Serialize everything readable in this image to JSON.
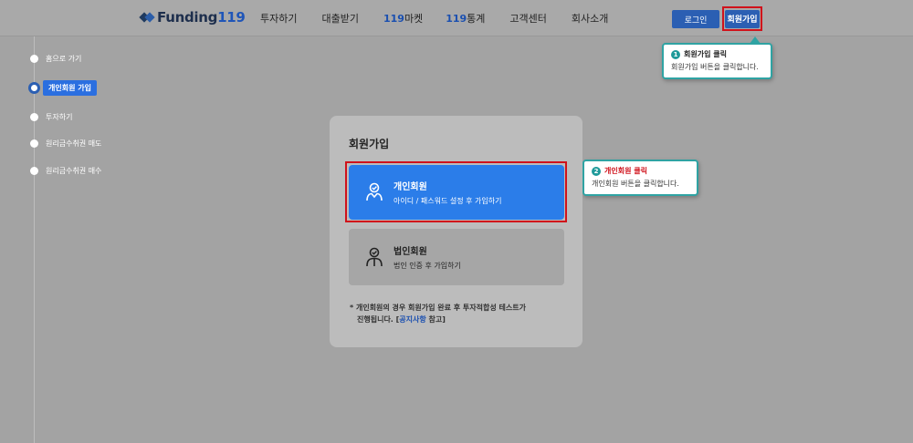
{
  "header": {
    "logo_text": "Funding",
    "logo_num": "119",
    "nav": [
      {
        "label": "투자하기"
      },
      {
        "label": "대출받기"
      },
      {
        "prefix": "119",
        "label": "마켓"
      },
      {
        "prefix": "119",
        "label": "통계"
      },
      {
        "label": "고객센터"
      },
      {
        "label": "회사소개"
      }
    ],
    "login_label": "로그인",
    "signup_label": "회원가입"
  },
  "timeline": {
    "steps": [
      {
        "label": "홈으로 가기"
      },
      {
        "label": "개인회원 가입",
        "active": true
      },
      {
        "label": "투자하기"
      },
      {
        "label": "원리금수취권 매도"
      },
      {
        "label": "원리금수취권 매수"
      }
    ]
  },
  "tips": [
    {
      "num": "1",
      "title": "회원가입 클릭",
      "body": "회원가입 버튼을 클릭합니다."
    },
    {
      "num": "2",
      "title": "개인회원 클릭",
      "body": "개인회원 버튼을 클릭합니다."
    }
  ],
  "modal": {
    "title": "회원가입",
    "personal": {
      "title": "개인회원",
      "sub": "아이디 / 패스워드 설정 후 가입하기"
    },
    "corporate": {
      "title": "법인회원",
      "sub": "법인 인증 후 가입하기"
    },
    "note_line1": "* 개인회원의 경우 회원가입 완료 후 투자적합성 테스트가",
    "note_line2_pre": "진행됩니다. [",
    "note_link": "공지사항",
    "note_line2_post": " 참고]"
  },
  "colors": {
    "accent": "#2b7de9",
    "button": "#2b5fb3",
    "highlight": "#d0121b",
    "tooltip_border": "#2fa3a3"
  }
}
